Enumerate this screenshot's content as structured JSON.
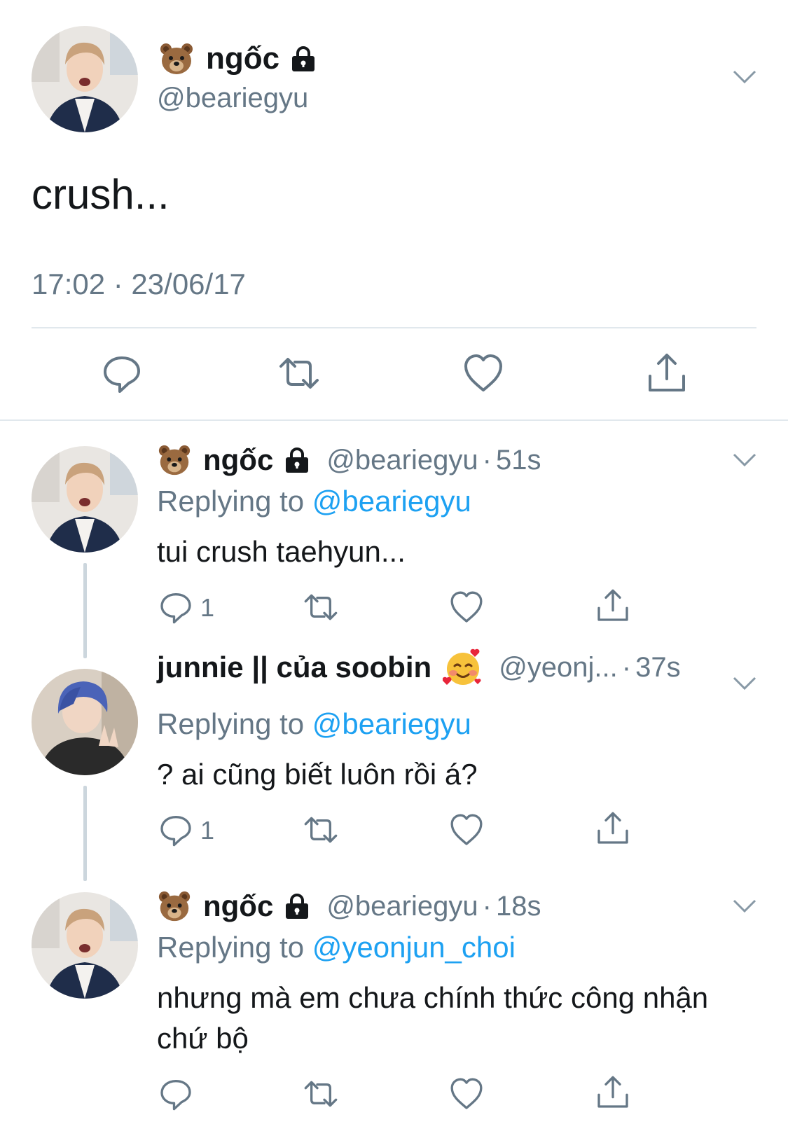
{
  "main_tweet": {
    "name": "ngốc",
    "handle": "@beariegyu",
    "text": "crush...",
    "timestamp": "17:02 · 23/06/17",
    "actions": [
      "reply-icon",
      "retweet-icon",
      "like-icon",
      "share-icon"
    ]
  },
  "replies": [
    {
      "name": "ngốc",
      "handle": "@beariegyu",
      "separator": "·",
      "time": "51s",
      "replying_prefix": "Replying to",
      "replying_to": "@beariegyu",
      "text": "tui crush taehyun...",
      "reply_count": "1"
    },
    {
      "name": "junnie || của soobin",
      "handle": "@yeonj...",
      "separator": "·",
      "time": "37s",
      "replying_prefix": "Replying to",
      "replying_to": "@beariegyu",
      "text": "? ai cũng biết luôn rồi á?",
      "reply_count": "1"
    },
    {
      "name": "ngốc",
      "handle": "@beariegyu",
      "separator": "·",
      "time": "18s",
      "replying_prefix": "Replying to",
      "replying_to": "@yeonjun_choi",
      "text": "nhưng mà em chưa chính thức công nhận chứ bộ",
      "reply_count": ""
    }
  ],
  "colors": {
    "text": "#14171a",
    "secondary": "#657786",
    "link": "#1da1f2",
    "divider": "#e1e8ed",
    "thread_line": "#ccd6dd"
  }
}
